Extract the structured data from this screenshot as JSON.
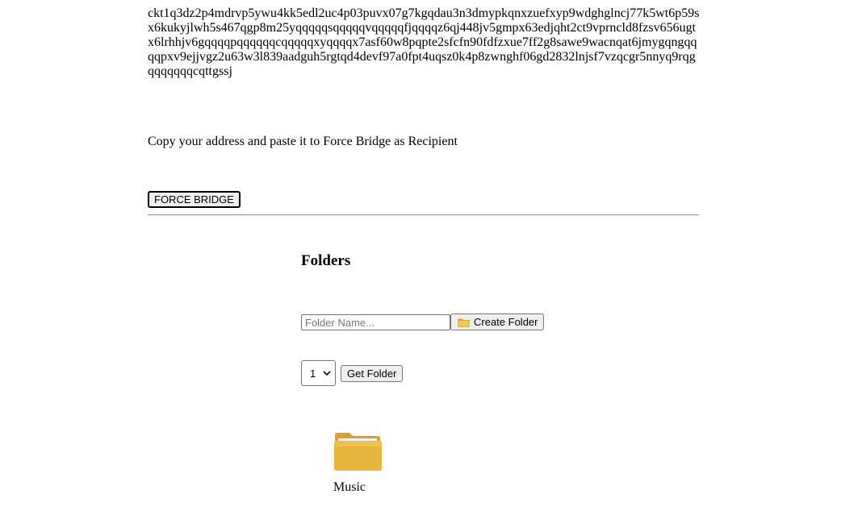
{
  "wallet": {
    "address": "ckt1q3dz2p4mdrvp5ywu4kk5edl2uc4p03puvx07g7kgqdau3n3dmypkqnxzuefxyp9wdghglncj77k5wt6p59sx6kukyjlwh5s467qgp8m25yqqqqqsqqqqqvqqqqqfjqqqqz6qj448jv5gmpx63edjqht2ct9vprncld8fzsv656ugtx6lrhhjv6gqqqqpqqqqqqcqqqqqxyqqqqx7asf60w8pqpte2sfcfn90fdfzxue7ff2g8sawe9wacnqat6jmygqngqqqqpxv9ejjvgz2u63w3l839aadguh5rgtqd4devf97a0fpt4uqsz0k4p8zwnghf06gd2832lnjsf7vzqcgr5nnyq9rqgqqqqqqqcqttgssj",
    "instruction": "Copy your address and paste it to Force Bridge as Recipient",
    "force_bridge_label": "FORCE BRIDGE"
  },
  "folders": {
    "title": "Folders",
    "name_placeholder": "Folder Name...",
    "create_label": "Create Folder",
    "selected_id": "1",
    "get_label": "Get Folder",
    "items": [
      {
        "name": "Music",
        "icon": "folder-icon"
      }
    ]
  },
  "colors": {
    "folder_body": "#e8b53c",
    "folder_back": "#d9a22a",
    "folder_paper": "#f4f4f4"
  }
}
